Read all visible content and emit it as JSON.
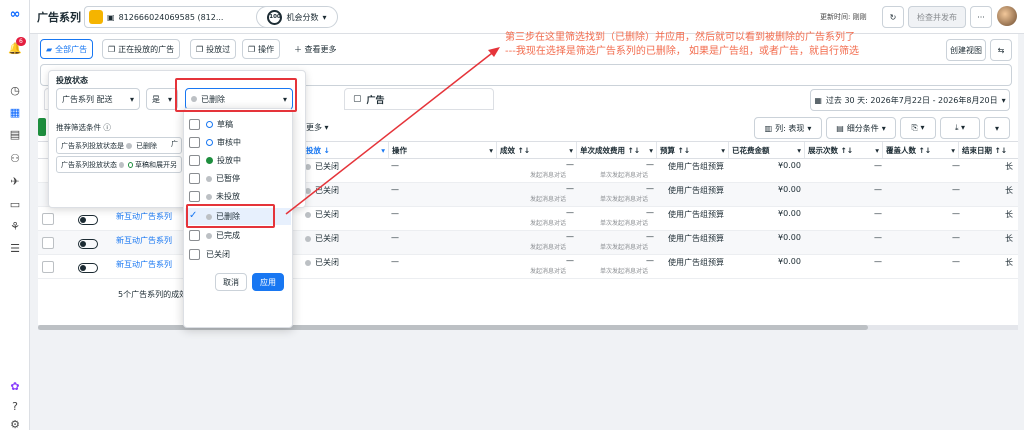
{
  "header": {
    "title": "广告系列",
    "account_id": "812666024069585 (812...",
    "score_value": "100",
    "score_label": "机会分数",
    "update_label": "更新时间: 刚刚",
    "review_publish": "检查并发布",
    "more": "···"
  },
  "toolbar": {
    "all_ads": "全部广告",
    "active_ads": "正在投放的广告",
    "delivered": "投放过",
    "actions": "操作",
    "view_more": "查看更多",
    "create_view": "创建视图"
  },
  "filter": {
    "title": "投放状态",
    "field": "广告系列 配送",
    "operator": "是",
    "value": "已删除",
    "recommended_title": "推荐筛选条件",
    "recommend_items": [
      {
        "label": "广告系列投放状态是",
        "value": "已删除",
        "extra": "广"
      },
      {
        "label": "广告系列投放状态",
        "value": "草稿和展开另",
        "extra": ""
      }
    ]
  },
  "dropdown": {
    "options": [
      {
        "label": "草稿",
        "style": "ring-blue",
        "checked": false
      },
      {
        "label": "审核中",
        "style": "ring-blue",
        "checked": false
      },
      {
        "label": "投放中",
        "style": "dot-green",
        "checked": false
      },
      {
        "label": "已暂停",
        "style": "dot-gray",
        "checked": false
      },
      {
        "label": "未投放",
        "style": "dot-gray",
        "checked": false
      },
      {
        "label": "已删除",
        "style": "dot-gray",
        "checked": true
      },
      {
        "label": "已完成",
        "style": "dot-gray",
        "checked": false
      },
      {
        "label": "已关闭",
        "style": "none",
        "checked": false
      }
    ],
    "cancel": "取消",
    "apply": "应用"
  },
  "tabs": {
    "ads": "广告"
  },
  "date_range": "过去 30 天: 2026年7月22日 - 2026年8月20日",
  "table_toolbar": {
    "more": "更多",
    "columns": "列: 表现",
    "breakdown": "细分条件"
  },
  "columns": [
    "投放",
    "操作",
    "成效",
    "单次成效费用",
    "预算",
    "已花费金额",
    "展示次数",
    "覆盖人数",
    "结束日期"
  ],
  "rows": [
    {
      "name": "",
      "delivery": "已关闭",
      "action": "—",
      "result": "—",
      "result_sub": "发起消息对话",
      "cost": "—",
      "cost_sub": "单次发起消息对话",
      "budget": "使用广告组预算",
      "spent": "¥0.00",
      "impressions": "—",
      "reach": "—",
      "end": "长"
    },
    {
      "name": "",
      "delivery": "已关闭",
      "action": "—",
      "result": "—",
      "result_sub": "发起消息对话",
      "cost": "—",
      "cost_sub": "单次发起消息对话",
      "budget": "使用广告组预算",
      "spent": "¥0.00",
      "impressions": "—",
      "reach": "—",
      "end": "长"
    },
    {
      "name": "新互动广告系列",
      "delivery": "已关闭",
      "action": "—",
      "result": "—",
      "result_sub": "发起消息对话",
      "cost": "—",
      "cost_sub": "单次发起消息对话",
      "budget": "使用广告组预算",
      "spent": "¥0.00",
      "impressions": "—",
      "reach": "—",
      "end": "长"
    },
    {
      "name": "新互动广告系列",
      "delivery": "已关闭",
      "action": "—",
      "result": "—",
      "result_sub": "发起消息对话",
      "cost": "—",
      "cost_sub": "单次发起消息对话",
      "budget": "使用广告组预算",
      "spent": "¥0.00",
      "impressions": "—",
      "reach": "—",
      "end": "长"
    },
    {
      "name": "新互动广告系列",
      "delivery": "已关闭",
      "action": "—",
      "result": "—",
      "result_sub": "发起消息对话",
      "cost": "—",
      "cost_sub": "单次发起消息对话",
      "budget": "使用广告组预算",
      "spent": "¥0.00",
      "impressions": "—",
      "reach": "—",
      "end": "长"
    }
  ],
  "summary": "5个广告系列的成效",
  "annotation": {
    "line1": "第三步在这里筛选找到（已删除）并应用，然后就可以看到被删除的广告系列了",
    "line2": "---我现在选择是筛选广告系列的已删除，  如果是广告组，或者广告，就自行筛选"
  },
  "notification_count": "6",
  "colors": {
    "accent": "#1877f2",
    "annotation": "#e5343a",
    "active_green": "#1e8e3e"
  }
}
